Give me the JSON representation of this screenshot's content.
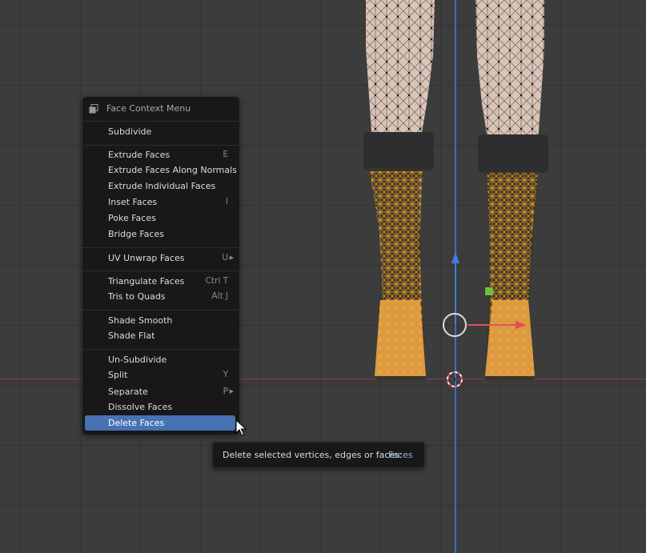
{
  "context_menu": {
    "title": "Face Context Menu",
    "items": [
      {
        "label": "Subdivide",
        "shortcut": ""
      },
      {
        "label": "Extrude Faces",
        "shortcut": "E"
      },
      {
        "label": "Extrude Faces Along Normals",
        "shortcut": ""
      },
      {
        "label": "Extrude Individual Faces",
        "shortcut": ""
      },
      {
        "label": "Inset Faces",
        "shortcut": "I"
      },
      {
        "label": "Poke Faces",
        "shortcut": ""
      },
      {
        "label": "Bridge Faces",
        "shortcut": ""
      },
      {
        "label": "UV Unwrap Faces",
        "shortcut": "U"
      },
      {
        "label": "Triangulate Faces",
        "shortcut": "Ctrl T"
      },
      {
        "label": "Tris to Quads",
        "shortcut": "Alt J"
      },
      {
        "label": "Shade Smooth",
        "shortcut": ""
      },
      {
        "label": "Shade Flat",
        "shortcut": ""
      },
      {
        "label": "Un-Subdivide",
        "shortcut": ""
      },
      {
        "label": "Split",
        "shortcut": "Y"
      },
      {
        "label": "Separate",
        "shortcut": "P"
      },
      {
        "label": "Dissolve Faces",
        "shortcut": ""
      },
      {
        "label": "Delete Faces",
        "shortcut": ""
      }
    ],
    "active_item": "Delete Faces",
    "submenu_items": [
      "UV Unwrap Faces",
      "Separate"
    ]
  },
  "tooltip": {
    "text": "Delete selected vertices, edges or faces:",
    "value": "Faces"
  },
  "colors": {
    "viewport_bg": "#3c3c3c",
    "grid": "#333333",
    "menu_bg": "#181818",
    "highlight": "#4772b3",
    "selection_orange": "#f5a623",
    "x_axis": "#e0505a",
    "z_axis": "#3b7ee6"
  },
  "icons": {
    "menu_icon": "face-menu-icon",
    "cursor": "mouse-pointer-icon",
    "submenu": "submenu-arrow-icon"
  }
}
